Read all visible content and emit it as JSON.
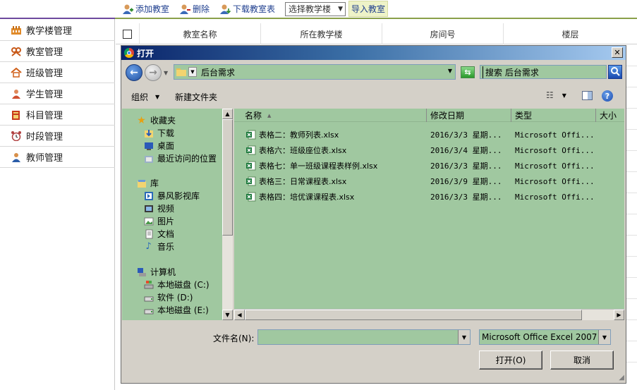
{
  "sidebar": {
    "items": [
      {
        "label": "教学楼管理",
        "icon": "building-icon"
      },
      {
        "label": "教室管理",
        "icon": "classroom-icon"
      },
      {
        "label": "班级管理",
        "icon": "home-icon"
      },
      {
        "label": "学生管理",
        "icon": "student-icon"
      },
      {
        "label": "科目管理",
        "icon": "book-icon"
      },
      {
        "label": "时段管理",
        "icon": "clock-icon"
      },
      {
        "label": "教师管理",
        "icon": "teacher-icon"
      }
    ]
  },
  "toolbar": {
    "add_label": "添加教室",
    "delete_label": "删除",
    "download_label": "下载教室表",
    "building_select": "选择教学楼",
    "import_label": "导入教室"
  },
  "grid": {
    "columns": [
      "教室名称",
      "所在教学楼",
      "房间号",
      "楼层"
    ]
  },
  "dialog": {
    "title": "打开",
    "address": "后台需求",
    "search_placeholder": "搜索 后台需求",
    "organize_label": "组织",
    "new_folder_label": "新建文件夹",
    "nav": {
      "favorites_label": "收藏夹",
      "favorites": [
        "下载",
        "桌面",
        "最近访问的位置"
      ],
      "libraries_label": "库",
      "libraries": [
        "暴风影视库",
        "视频",
        "图片",
        "文档",
        "音乐"
      ],
      "computer_label": "计算机",
      "drives": [
        "本地磁盘 (C:)",
        "软件 (D:)",
        "本地磁盘 (E:)"
      ]
    },
    "columns": {
      "name": "名称",
      "date": "修改日期",
      "type": "类型",
      "size": "大小"
    },
    "files": [
      {
        "name": "表格二：教师列表.xlsx",
        "date": "2016/3/3 星期...",
        "type": "Microsoft Offi..."
      },
      {
        "name": "表格六：班级座位表.xlsx",
        "date": "2016/3/4 星期...",
        "type": "Microsoft Offi..."
      },
      {
        "name": "表格七：单一班级课程表样例.xlsx",
        "date": "2016/3/3 星期...",
        "type": "Microsoft Offi..."
      },
      {
        "name": "表格三：日常课程表.xlsx",
        "date": "2016/3/9 星期...",
        "type": "Microsoft Offi..."
      },
      {
        "name": "表格四：培优课课程表.xlsx",
        "date": "2016/3/3 星期...",
        "type": "Microsoft Offi..."
      }
    ],
    "filename_label": "文件名(N):",
    "filename_value": "",
    "filter_value": "Microsoft Office Excel 2007",
    "open_label": "打开(O)",
    "cancel_label": "取消"
  },
  "colors": {
    "accent_purple": "#6e4a9e",
    "toolbar_line": "#8aa04a",
    "pane_green": "#a0c8a0",
    "dialog_face": "#d4d0c8"
  }
}
